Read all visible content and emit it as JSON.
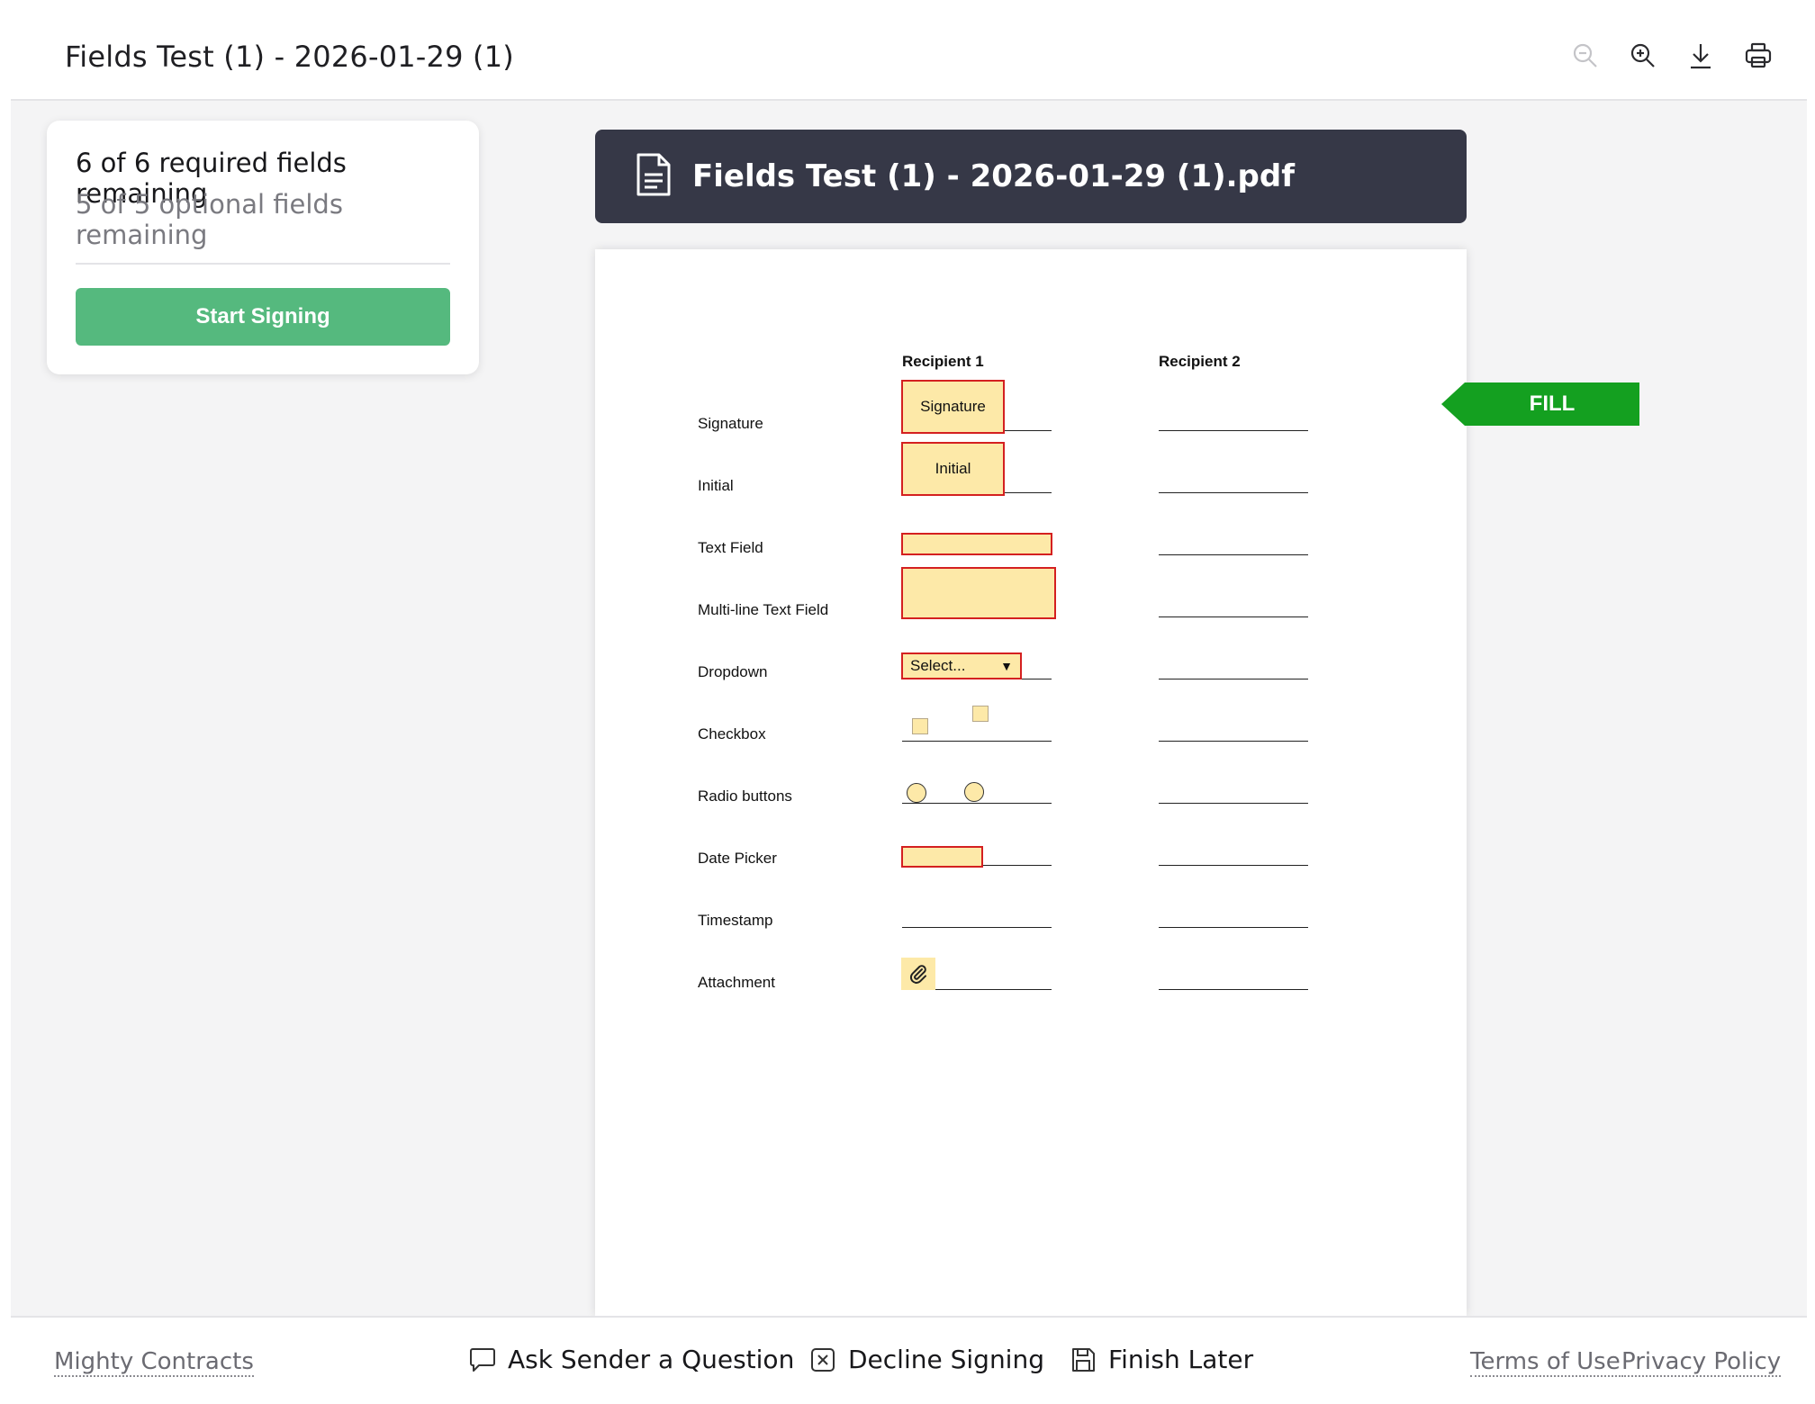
{
  "header": {
    "title": "Fields Test (1) - 2026-01-29 (1)",
    "tools": [
      "zoom-out-icon",
      "zoom-in-icon",
      "download-icon",
      "print-icon"
    ]
  },
  "progress": {
    "required": "6 of 6 required fields remaining",
    "optional": "5 of 5 optional fields remaining",
    "start_label": "Start Signing"
  },
  "document": {
    "file_name": "Fields Test (1) - 2026-01-29 (1).pdf",
    "columns": [
      "Recipient 1",
      "Recipient 2"
    ],
    "rows": [
      "Signature",
      "Initial",
      "Text Field",
      "Multi-line Text Field",
      "Dropdown",
      "Checkbox",
      "Radio buttons",
      "Date Picker",
      "Timestamp",
      "Attachment"
    ],
    "fields": {
      "signature": "Signature",
      "initial": "Initial",
      "dropdown": "Select..."
    }
  },
  "fill_tag": "FILL",
  "footer": {
    "brand": "Mighty Contracts",
    "ask": "Ask Sender a Question",
    "decline": "Decline Signing",
    "finish": "Finish Later",
    "terms": "Terms of Use",
    "privacy": "Privacy Policy"
  },
  "colors": {
    "start_button": "#55b97e",
    "pdf_header": "#363847",
    "field_fill": "#fde9a8",
    "field_border": "#d42020",
    "fill_tag": "#14a020"
  }
}
